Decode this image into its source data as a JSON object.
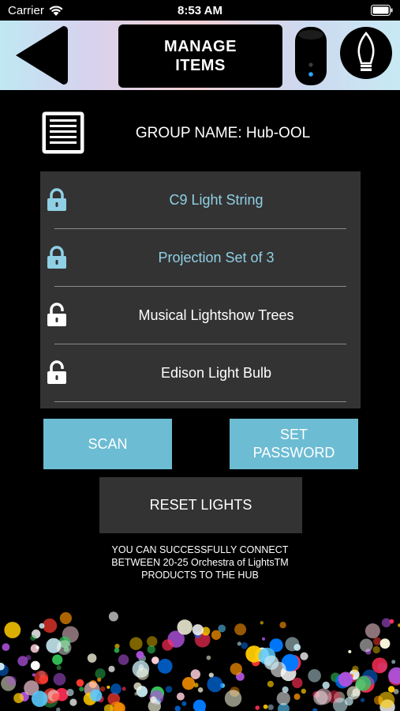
{
  "status_bar": {
    "carrier": "Carrier",
    "time": "8:53 AM"
  },
  "header": {
    "title_line1": "MANAGE",
    "title_line2": "ITEMS",
    "back_icon": "back-triangle-icon",
    "hub_icon": "hub-device-icon",
    "bulb_icon": "bulb-icon"
  },
  "group": {
    "label": "GROUP NAME: Hub-OOL"
  },
  "items": [
    {
      "label": "C9 Light String",
      "locked": true,
      "color": "#8fd0e6"
    },
    {
      "label": "Projection Set of 3",
      "locked": true,
      "color": "#8fd0e6"
    },
    {
      "label": "Musical Lightshow Trees",
      "locked": false,
      "color": "#ffffff"
    },
    {
      "label": "Edison Light Bulb",
      "locked": false,
      "color": "#ffffff"
    }
  ],
  "buttons": {
    "scan": "SCAN",
    "set_password_line1": "SET",
    "set_password_line2": "PASSWORD",
    "reset": "RESET LIGHTS"
  },
  "info": {
    "line1": "YOU CAN SUCCESSFULLY CONNECT",
    "line2": "BETWEEN 20-25 Orchestra of LightsTM",
    "line3": "PRODUCTS TO THE HUB"
  },
  "colors": {
    "accent_blue": "#6cbcd3",
    "locked_text": "#8fd0e6",
    "panel": "#333333"
  }
}
